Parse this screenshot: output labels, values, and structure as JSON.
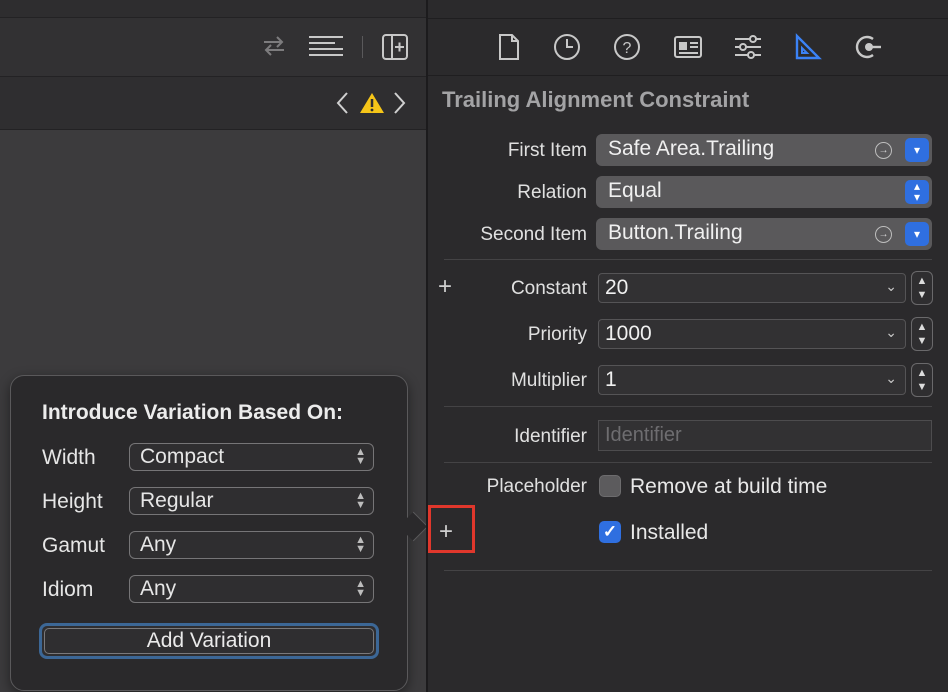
{
  "editor": {
    "toolbar_icons": [
      "swap-arrows-icon",
      "lines-icon",
      "add-editor-icon"
    ],
    "jumpbar": {
      "back_icon": "chevron-left-icon",
      "warning_icon": "warning-icon",
      "forward_icon": "chevron-right-icon"
    }
  },
  "popover": {
    "title": "Introduce Variation Based On:",
    "rows": [
      {
        "label": "Width",
        "value": "Compact"
      },
      {
        "label": "Height",
        "value": "Regular"
      },
      {
        "label": "Gamut",
        "value": "Any"
      },
      {
        "label": "Idiom",
        "value": "Any"
      }
    ],
    "button_label": "Add Variation"
  },
  "inspector": {
    "tab_icons": [
      "file-icon",
      "history-icon",
      "help-icon",
      "identity-icon",
      "attributes-icon",
      "size-ruler-icon",
      "connections-icon"
    ],
    "active_tab": "size-ruler-icon",
    "title": "Trailing Alignment Constraint",
    "first_item": {
      "label": "First Item",
      "value": "Safe Area.Trailing"
    },
    "relation": {
      "label": "Relation",
      "value": "Equal"
    },
    "second_item": {
      "label": "Second Item",
      "value": "Button.Trailing"
    },
    "constant": {
      "label": "Constant",
      "value": "20"
    },
    "priority": {
      "label": "Priority",
      "value": "1000"
    },
    "multiplier": {
      "label": "Multiplier",
      "value": "1"
    },
    "identifier": {
      "label": "Identifier",
      "placeholder": "Identifier"
    },
    "placeholder_opt": {
      "label": "Placeholder",
      "checkbox_label": "Remove at build time",
      "checked": false
    },
    "installed": {
      "checkbox_label": "Installed",
      "checked": true
    }
  },
  "colors": {
    "accent": "#2f6fe0",
    "highlight": "#e0372c",
    "warning": "#f5c518"
  }
}
